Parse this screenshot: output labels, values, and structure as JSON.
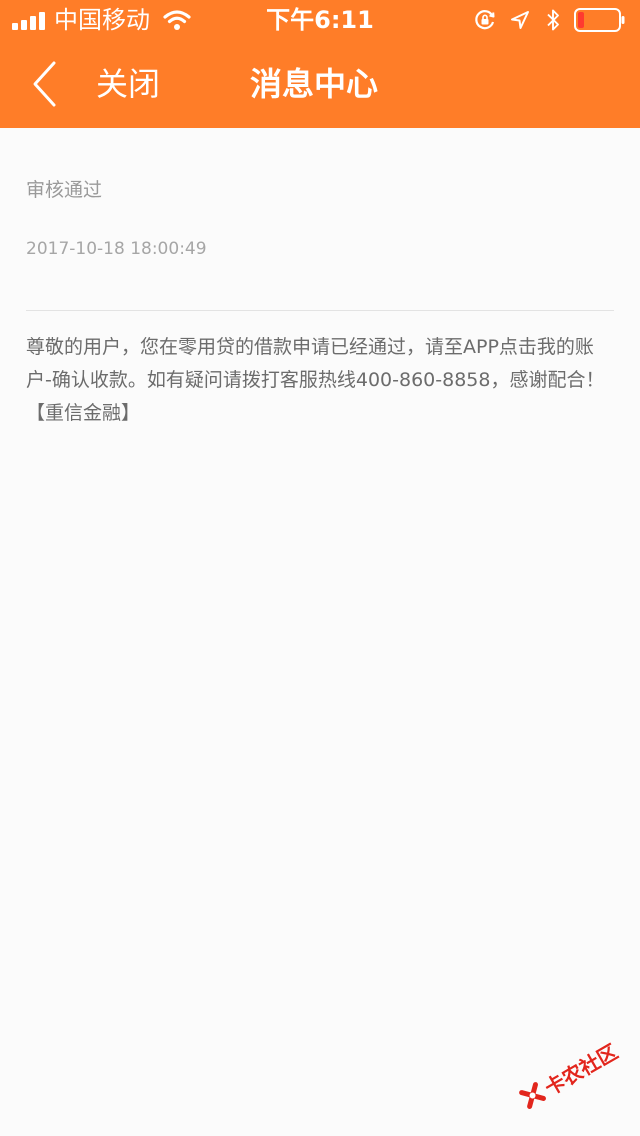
{
  "status_bar": {
    "carrier": "中国移动",
    "time": "下午6:11",
    "icons": [
      "signal-icon",
      "wifi-icon",
      "orientation-lock-icon",
      "location-icon",
      "bluetooth-icon",
      "battery-icon"
    ],
    "battery_level": 0.12
  },
  "nav": {
    "back_icon": "chevron-left-icon",
    "close_label": "关闭",
    "title": "消息中心"
  },
  "message": {
    "title": "审核通过",
    "timestamp": "2017-10-18 18:00:49",
    "body": "尊敬的用户，您在零用贷的借款申请已经通过，请至APP点击我的账户-确认收款。如有疑问请拨打客服热线400-860-8858，感谢配合！【重信金融】"
  },
  "watermark": {
    "text": "卡农社区"
  },
  "colors": {
    "header": "#ff7d28",
    "header_text": "#ffffff",
    "background": "#fbfbfb",
    "muted_text": "#9a9a9a",
    "body_text": "#6c6c6c",
    "battery_low": "#ff3b30",
    "watermark": "#e2261d"
  }
}
